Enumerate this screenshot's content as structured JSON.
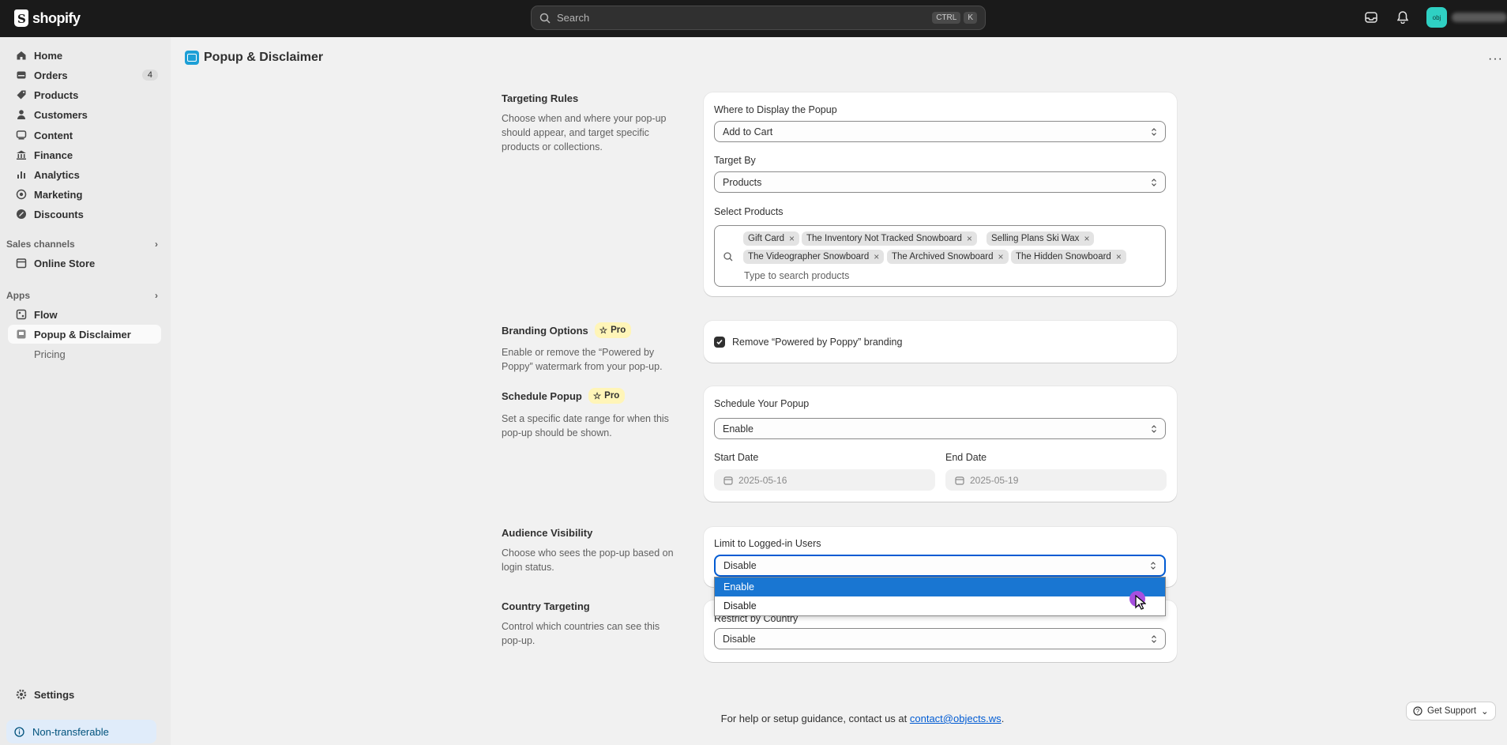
{
  "topbar": {
    "brand": "shopify",
    "search_placeholder": "Search",
    "kbd_ctrl": "CTRL",
    "kbd_k": "K",
    "avatar_initials": "obj"
  },
  "sidebar": {
    "items": [
      {
        "label": "Home"
      },
      {
        "label": "Orders",
        "badge": "4"
      },
      {
        "label": "Products"
      },
      {
        "label": "Customers"
      },
      {
        "label": "Content"
      },
      {
        "label": "Finance"
      },
      {
        "label": "Analytics"
      },
      {
        "label": "Marketing"
      },
      {
        "label": "Discounts"
      }
    ],
    "sales_channels_label": "Sales channels",
    "online_store": "Online Store",
    "apps_label": "Apps",
    "flow": "Flow",
    "popup_app": "Popup & Disclaimer",
    "pricing": "Pricing",
    "settings": "Settings",
    "non_transferable": "Non-transferable"
  },
  "page": {
    "title": "Popup & Disclaimer",
    "more": "···"
  },
  "targeting": {
    "title": "Targeting Rules",
    "desc": "Choose when and where your pop-up should appear, and target specific products or collections.",
    "where_label": "Where to Display the Popup",
    "where_value": "Add to Cart",
    "target_by_label": "Target By",
    "target_by_value": "Products",
    "select_products_label": "Select Products",
    "tags": [
      "Gift Card",
      "The Inventory Not Tracked Snowboard",
      "Selling Plans Ski Wax",
      "The Videographer Snowboard",
      "The Archived Snowboard",
      "The Hidden Snowboard"
    ],
    "products_placeholder": "Type to search products"
  },
  "branding": {
    "title": "Branding Options",
    "pro": "Pro",
    "desc": "Enable or remove the “Powered by Poppy” watermark from your pop-up.",
    "checkbox_label": "Remove “Powered by Poppy” branding",
    "checked": true
  },
  "schedule": {
    "title": "Schedule Popup",
    "pro": "Pro",
    "desc": "Set a specific date range for when this pop-up should be shown.",
    "schedule_label": "Schedule Your Popup",
    "schedule_value": "Enable",
    "start_label": "Start Date",
    "start_value": "2025-05-16",
    "end_label": "End Date",
    "end_value": "2025-05-19"
  },
  "audience": {
    "title": "Audience Visibility",
    "desc": "Choose who sees the pop-up based on login status.",
    "limit_label": "Limit to Logged-in Users",
    "limit_value": "Disable",
    "options": [
      "Enable",
      "Disable"
    ]
  },
  "country": {
    "title": "Country Targeting",
    "desc": "Control which countries can see this pop-up.",
    "restrict_label": "Restrict by Country",
    "restrict_value": "Disable"
  },
  "footer": {
    "help_text": "For help or setup guidance, contact us at ",
    "email": "contact@objects.ws",
    "period": ".",
    "get_support": "Get Support"
  },
  "colors": {
    "accent": "#005bd3",
    "topbar": "#1a1a1a",
    "selected_option": "#1976d2"
  }
}
